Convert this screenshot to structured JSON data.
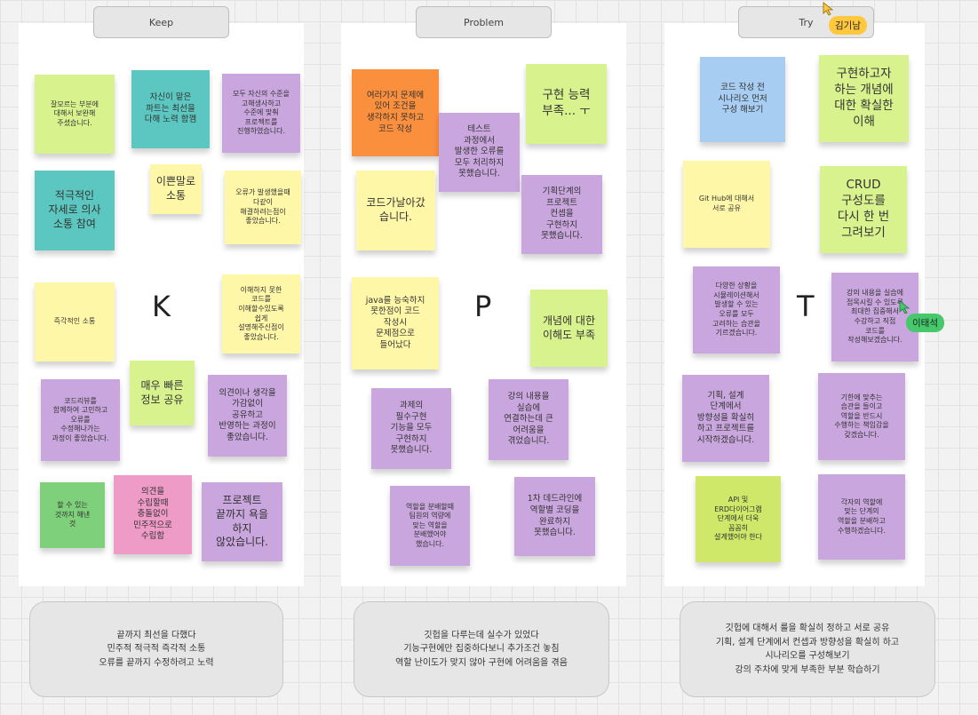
{
  "board": {
    "headers": {
      "keep": "Keep",
      "problem": "Problem",
      "try": "Try"
    },
    "letters": {
      "keep": "K",
      "problem": "P",
      "try": "T"
    }
  },
  "colors": {
    "lime": "#d8f28e",
    "teal": "#5cc7c0",
    "purple": "#c9a6dd",
    "yellow": "#fff7a8",
    "green": "#7ed07a",
    "pink": "#ef9bc7",
    "orange": "#fa8f3e",
    "blue": "#a8cdf2",
    "bright_green": "#cfe86a",
    "cursor_gold": "#ffc83d",
    "cursor_green": "#45c96b"
  },
  "keep_notes": [
    "잘모르는 부분에\n대해서 보완해\n주셨습니다.",
    "자신이 맡은\n파트는 최선을\n다해 노력 함껨",
    "모두 자신의 수준을\n고해생사하고\n수준에 맞춰\n프로젝트를\n진행하였습니다.",
    "적극적인\n자세로 의사\n소통 참여",
    "이쁜말로\n소통",
    "오류가 발생했을때\n다같이\n해결하려는점이\n좋았습니다.",
    "즉각적인 소통",
    "이해하지 못한\n코드를\n이해할수있도록\n쉽게\n설명해주신점이\n좋았습니다.",
    "매우 빠른\n정보 공유",
    "코드리뷰를\n함께하여 고민하고\n오류를\n수정해나가는\n과정이 좋았습니다.",
    "의견이나 생각을\n가감없이\n공유하고\n반영하는 과정이\n좋았습니다.",
    "할 수 있는\n것까지 해낸\n것",
    "의견을\n수립할때\n충돌없이\n민주적으로\n수립함",
    "프로젝트\n끝까지 욕을\n하지\n않았습니다."
  ],
  "problem_notes": [
    "여러가지 문제에\n있어 조건을\n생각하지 못하고\n코드 작성",
    "테스트\n과정에서\n발생한 오류를\n모두 처리하지\n못했습니다.",
    "구현 능력\n부족... ㅜ",
    "코드가날아갔\n습니다.",
    "기획단계의\n프로젝트\n컨셉을\n구현하지\n못했습니다.",
    "java를 능숙하지\n못한점이 코드\n작성시\n문제점으로\n들어났다",
    "개념에 대한\n이해도 부족",
    "과제의\n필수구현\n기능을 모두\n구현하지\n못했습니다.",
    "강의 내용을\n실습에\n연결하는데 큰\n어려움을\n겪었습니다.",
    "역할을 분배할때\n팀원의 역량에\n맞는 역할을\n분배했어야\n했습니다.",
    "1차 데드라인에\n역할별 코딩을\n완료하지\n못했습니다."
  ],
  "try_notes": [
    "코드 작성 전\n시나리오 먼저\n구성 해보기",
    "구현하고자\n하는 개념에\n대한 확실한\n이해",
    "Git Hub에 대해서\n서로 공유",
    "CRUD\n구성도를\n다시 한 번\n그려보기",
    "다양한 상황을\n시뮬레이션해서\n발생할 수 있는\n오류를 모두\n고려하는 습관을\n기르겠습니다.",
    "강의 내용을 실습에\n접목시킬 수 있도록\n최대한 집중해서\n수강하고 직접\n코드를\n작성해보겠습니다.",
    "기획, 설계\n단계에서\n방향성을 확실히\n하고 프로젝트를\n시작하겠습니다.",
    "기한에 맞추는\n습관을 들이고\n역할을 반드시\n수행하는 책임감을\n갖겠습니다.",
    "API 및\nERD다이어그램\n단계에서 더욱\n꼼꼼히\n설계했어야 한다",
    "각자의 역할에\n맞는 단계의\n역할을 분배하고\n수행하겠습니다."
  ],
  "summaries": {
    "keep": "끝까지 최선을 다했다\n민주적 적극적 즉각적 소통\n오류를 끝까지 수정하려고 노력",
    "problem": "깃헙을 다루는데 실수가 있었다\n기능구현에만 집중하다보니 추가조건 놓침\n역할 난이도가 맞지 않아 구현에 어려움을 겪음",
    "try": "깃헙에 대해서 룰을 확실히 정하고 서로 공유\n기획, 설계 단계에서 컨셉과 방향성을 확실히 하고\n시나리오를 구성해보기\n강의 주차에 맞게 부족한 부분 학습하기"
  },
  "cursors": {
    "user1": "김기남",
    "user2": "이태석"
  }
}
